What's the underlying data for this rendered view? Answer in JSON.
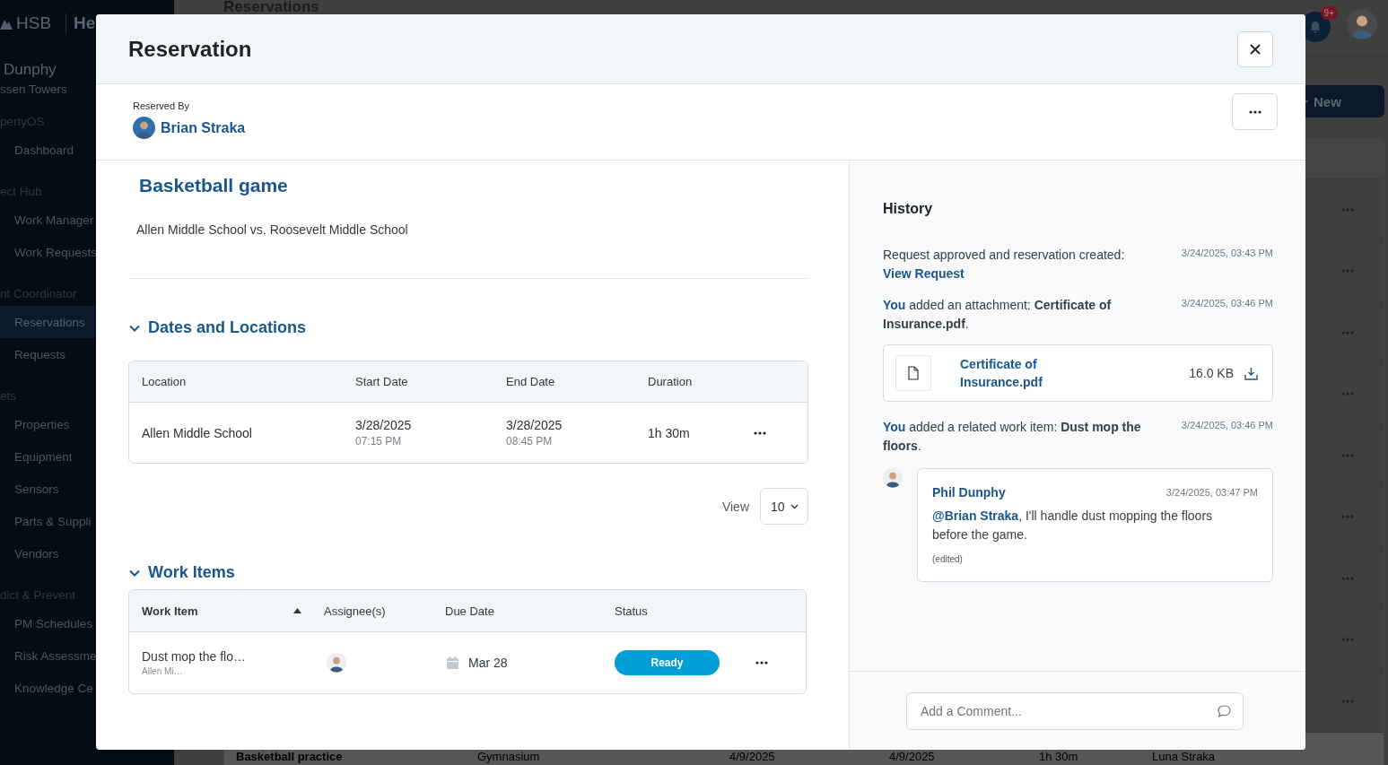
{
  "sidebar": {
    "brand": "HSB",
    "app_name": "He",
    "user_name": "Dunphy",
    "site": "ssen Towers",
    "sections": [
      {
        "heading": "pertyOS",
        "items": [
          {
            "label": "Dashboard",
            "selected": false
          }
        ]
      },
      {
        "heading": "ect Hub",
        "items": [
          {
            "label": "Work Manager",
            "selected": false
          },
          {
            "label": "Work Requests",
            "selected": false
          }
        ]
      },
      {
        "heading": "nt Coordinator",
        "items": [
          {
            "label": "Reservations",
            "selected": true
          },
          {
            "label": "Requests",
            "selected": false
          }
        ]
      },
      {
        "heading": "ets",
        "items": [
          {
            "label": "Properties",
            "selected": false
          },
          {
            "label": "Equipment",
            "selected": false
          },
          {
            "label": "Sensors",
            "selected": false
          },
          {
            "label": "Parts & Suppli",
            "selected": false
          },
          {
            "label": "Vendors",
            "selected": false
          }
        ]
      },
      {
        "heading": "dict & Prevent",
        "items": [
          {
            "label": "PM Schedules",
            "selected": false
          },
          {
            "label": "Risk Assessme",
            "selected": false
          },
          {
            "label": "Knowledge Ce",
            "selected": false
          }
        ]
      }
    ]
  },
  "page": {
    "title": "Reservations",
    "notification_count": "9+",
    "new_button": "New",
    "last_row": [
      "Basketball practice",
      "Gymnasium",
      "4/9/2025",
      "4/9/2025",
      "1h 30m",
      "Luna Straka"
    ]
  },
  "modal": {
    "title": "Reservation",
    "reserved_by_label": "Reserved By",
    "reserved_by": "Brian Straka",
    "name": "Basketball game",
    "description": "Allen Middle School vs. Roosevelt Middle School",
    "dates_section": {
      "title": "Dates and Locations",
      "expanded": true,
      "columns": [
        "Location",
        "Start Date",
        "End Date",
        "Duration"
      ],
      "rows": [
        {
          "location": "Allen Middle School",
          "start_date": "3/28/2025",
          "start_time": "07:15 PM",
          "end_date": "3/28/2025",
          "end_time": "08:45 PM",
          "duration": "1h 30m"
        }
      ],
      "view_label": "View",
      "page_size": "10"
    },
    "work_items_section": {
      "title": "Work Items",
      "expanded": true,
      "columns": [
        {
          "label": "Work Item",
          "sort_ascending": true
        },
        {
          "label": "Assignee(s)",
          "sort_ascending": false
        },
        {
          "label": "Due Date",
          "sort_ascending": false
        },
        {
          "label": "Status",
          "sort_ascending": false
        }
      ],
      "rows": [
        {
          "name": "Dust mop the flo…",
          "location": "Allen Mi…",
          "due_date": "Mar 28",
          "status": "Ready"
        }
      ]
    },
    "history": {
      "title": "History",
      "entries": [
        {
          "kind": "event",
          "text": "Request approved and reservation created:",
          "link": "View Request",
          "time": "3/24/2025, 03:43 PM"
        },
        {
          "kind": "event",
          "actor": "You",
          "text": "added an attachment: **Certificate of Insurance.pdf**.",
          "time": "3/24/2025, 03:46 PM"
        },
        {
          "kind": "file",
          "file_name": "Certificate of Insurance.pdf",
          "size": "16.0 KB"
        },
        {
          "kind": "event",
          "actor": "You",
          "text": "added a related work item: **Dust mop the floors**.",
          "time": "3/24/2025, 03:46 PM"
        },
        {
          "kind": "comment",
          "author": "Phil Dunphy",
          "time": "3/24/2025, 03:47 PM",
          "mention": "@Brian Straka",
          "text": ", I'll handle dust mopping the floors before the game.",
          "note": "(edited)"
        }
      ],
      "comment_placeholder": "Add a Comment..."
    }
  }
}
